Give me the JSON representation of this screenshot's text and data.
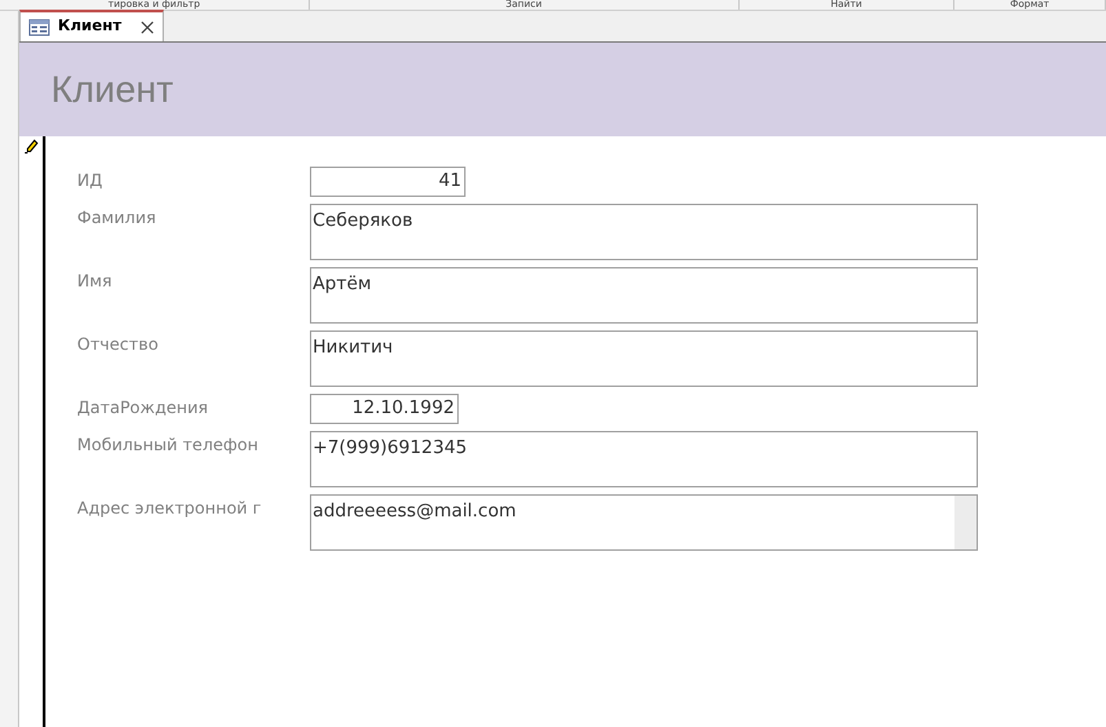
{
  "ribbon_groups": [
    "тировка и фильтр",
    "Записи",
    "Найти",
    "Формат"
  ],
  "tabs": [
    {
      "label": "Клиент",
      "selected": true
    }
  ],
  "form": {
    "title": "Клиент",
    "record_editing": true,
    "fields": [
      {
        "label": "ИД",
        "value": "41",
        "kind": "number",
        "focused": false
      },
      {
        "label": "Фамилия",
        "value": "Себеряков",
        "kind": "text",
        "focused": false
      },
      {
        "label": "Имя",
        "value": "Артём",
        "kind": "text",
        "focused": false
      },
      {
        "label": "Отчество",
        "value": "Никитич",
        "kind": "text",
        "focused": false
      },
      {
        "label": "ДатаРождения",
        "value": "12.10.1992",
        "kind": "date",
        "focused": false
      },
      {
        "label": "Мобильный телефон",
        "value": "+7(999)6912345",
        "kind": "text",
        "focused": false
      },
      {
        "label": "Адрес электронной г",
        "value": "addreeeess@mail.com",
        "kind": "text",
        "focused": true
      }
    ]
  }
}
